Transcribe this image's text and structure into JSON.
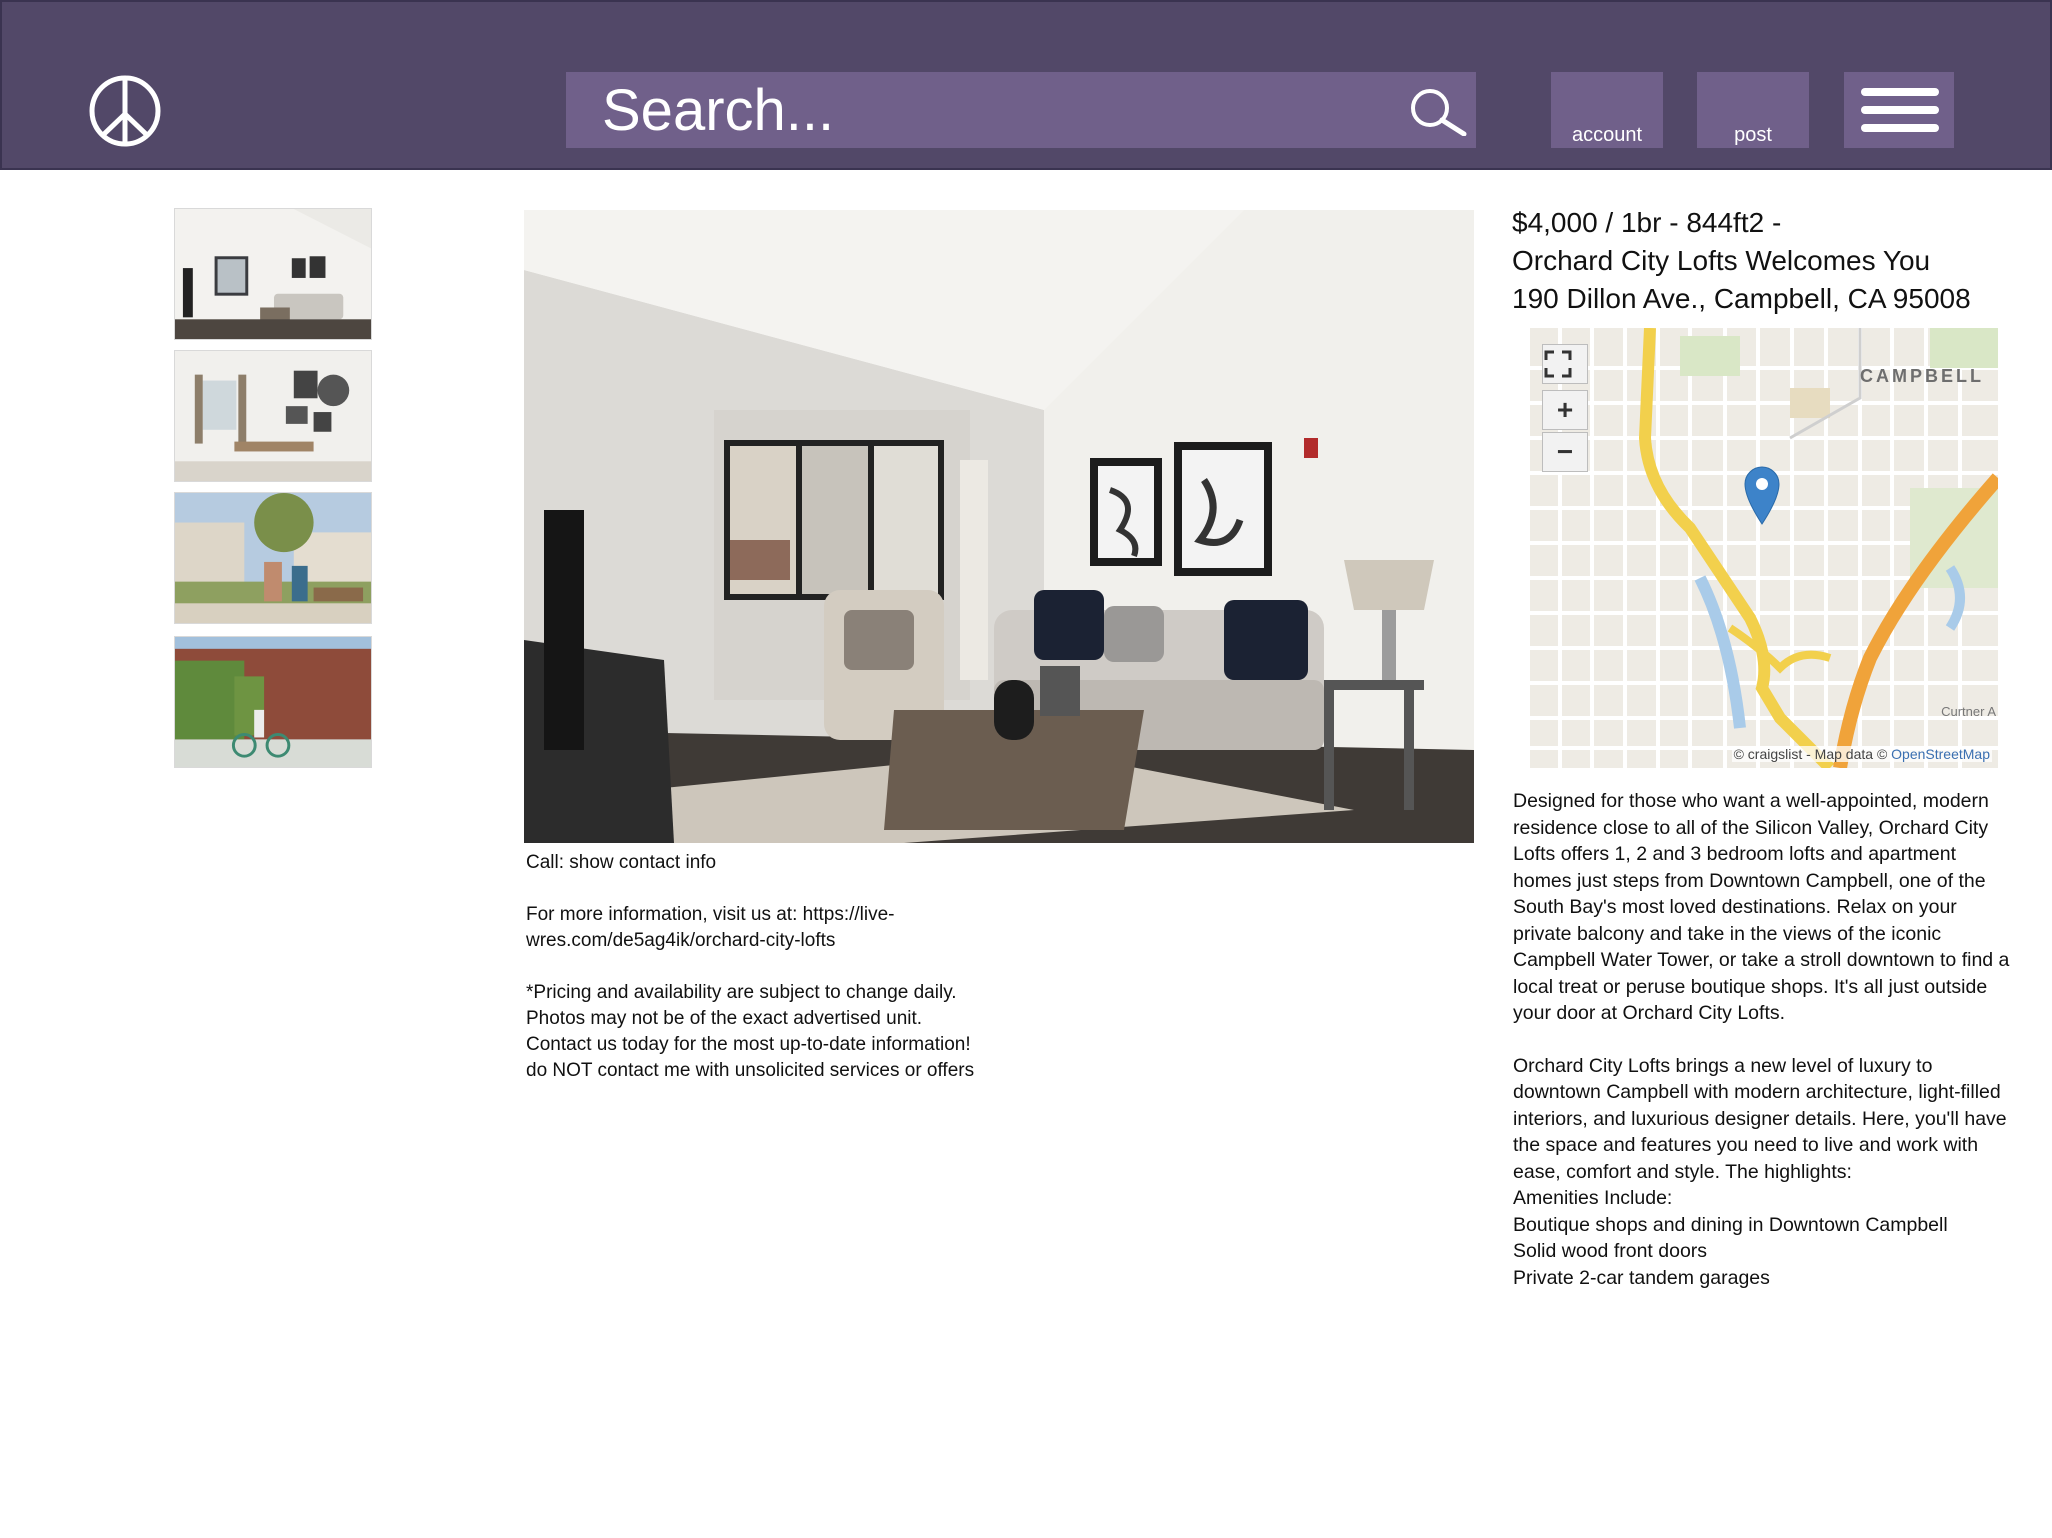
{
  "header": {
    "search_placeholder": "Search...",
    "account_label": "account",
    "post_label": "post",
    "logo_icon": "peace-icon",
    "menu_icon": "hamburger-menu-icon",
    "colors": {
      "bar": "#524868",
      "controls": "#70608a"
    }
  },
  "gallery": {
    "thumbnails": [
      "living-room",
      "office",
      "courtyard",
      "bicycle-wall"
    ]
  },
  "listing": {
    "title_line1": "$4,000 / 1br - 844ft2 -",
    "title_line2": "Orchard City Lofts Welcomes You",
    "address": "190 Dillon Ave., Campbell, CA 95008"
  },
  "map": {
    "city_label": "CAMPBELL",
    "street_label": "Curtner A",
    "attribution": "© craigslist - Map data ©",
    "attribution_link": "OpenStreetMap",
    "fullscreen_icon": "fullscreen-icon",
    "zoom_in": "+",
    "zoom_out": "−"
  },
  "contact": {
    "call_prefix": "Call:",
    "call_link": "show contact info",
    "more_info": "For more information, visit us at: https://live-",
    "url_rest": "wres.com/de5ag4ik/orchard-city-lofts",
    "pricing_note": "*Pricing and availability are subject to change daily. Photos may not be of the exact advertised unit. Contact us today for the most up-to-date information!",
    "no_solicit": "do NOT contact me with unsolicited services or offers"
  },
  "description": {
    "paragraph1": "Designed for those who want a well-appointed, modern residence close to all of the Silicon Valley, Orchard City Lofts offers 1, 2 and 3 bedroom lofts and apartment homes just steps from Downtown Campbell, one of the South Bay's most loved destinations. Relax on your private balcony and take in the views of the iconic Campbell Water Tower, or take a stroll downtown to find a local treat or peruse boutique shops. It's all just outside your door at Orchard City Lofts.",
    "paragraph2": "Orchard City Lofts brings a new level of luxury to downtown Campbell with modern architecture, light-filled interiors, and luxurious designer details. Here, you'll have the space and features you need to live and work with ease, comfort and style. The highlights:",
    "amenities_heading": "Amenities Include:",
    "amenities": [
      "Boutique shops and dining in Downtown Campbell",
      "Solid wood front doors",
      "Private 2-car tandem garages"
    ]
  }
}
